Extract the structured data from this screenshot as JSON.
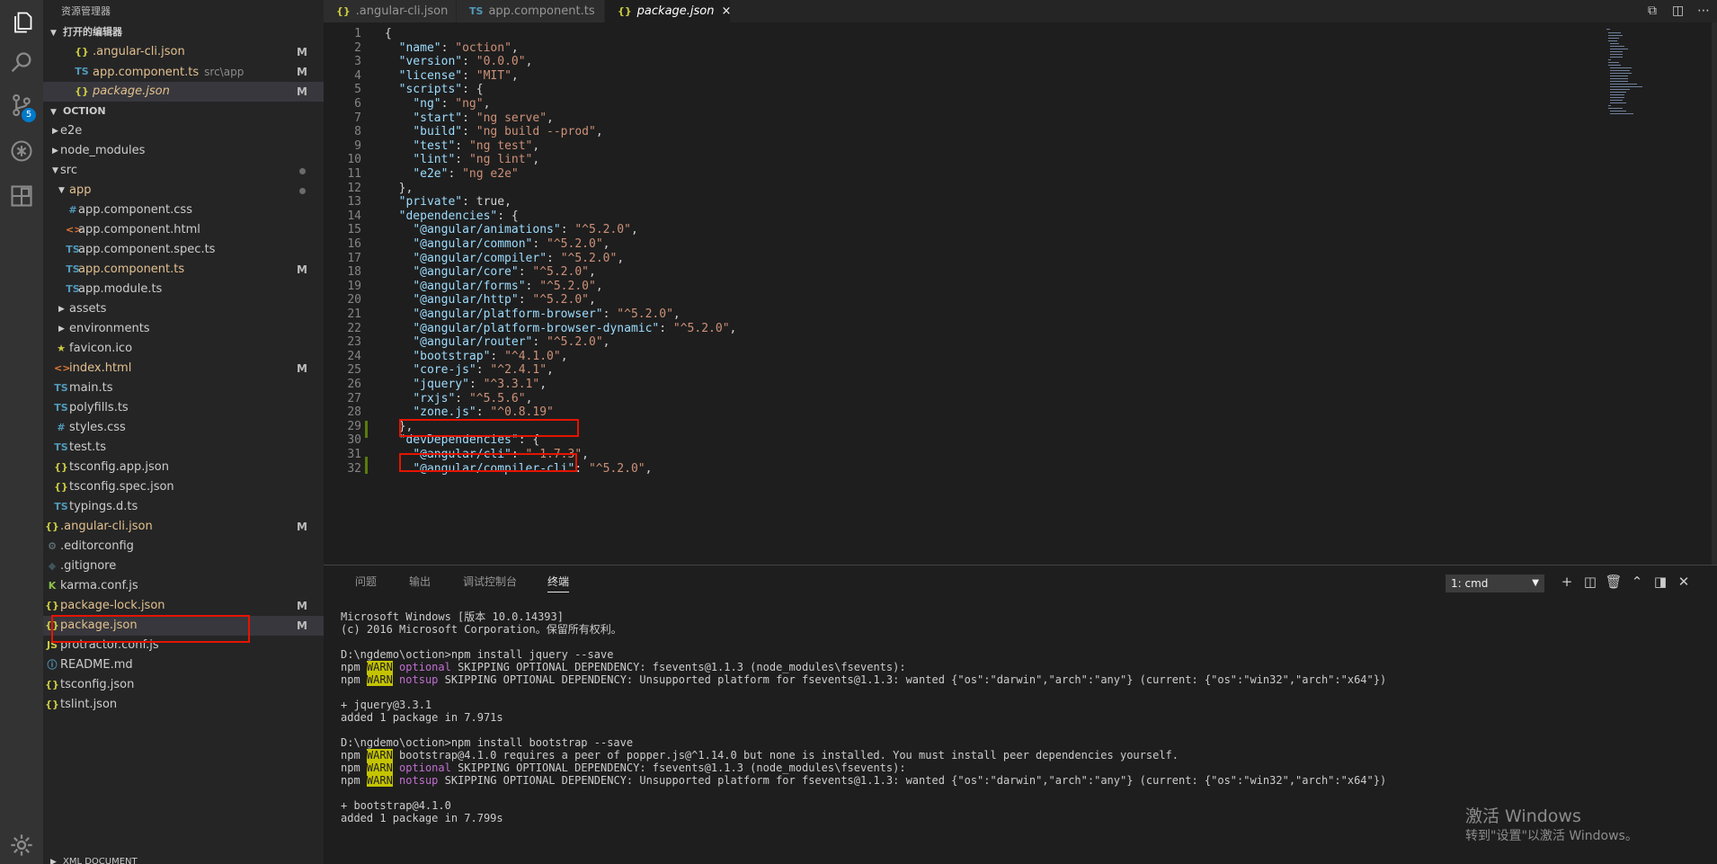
{
  "activity_bar": {
    "items": [
      {
        "name": "explorer-icon"
      },
      {
        "name": "search-icon"
      },
      {
        "name": "source-control-icon",
        "badge": "5"
      },
      {
        "name": "debug-icon"
      },
      {
        "name": "extensions-icon"
      }
    ],
    "settings": "gear-icon"
  },
  "sidebar": {
    "title": "资源管理器",
    "open_editors": {
      "header": "打开的编辑器",
      "items": [
        {
          "icon": "{}",
          "name": ".angular-cli.json",
          "desc": "",
          "status": "M"
        },
        {
          "icon": "TS",
          "name": "app.component.ts",
          "desc": "src\\app",
          "status": "M"
        },
        {
          "icon": "{}",
          "name": "package.json",
          "desc": "",
          "status": "M"
        }
      ]
    },
    "project": {
      "header": "OCTION",
      "items": [
        {
          "name": "e2e",
          "status": ""
        },
        {
          "name": "node_modules",
          "status": ""
        },
        {
          "name": "src",
          "status": ""
        },
        {
          "name": "app",
          "status": ""
        },
        {
          "icon": "#",
          "name": "app.component.css",
          "status": ""
        },
        {
          "icon": "<>",
          "name": "app.component.html",
          "status": ""
        },
        {
          "icon": "TS",
          "name": "app.component.spec.ts",
          "status": ""
        },
        {
          "icon": "TS",
          "name": "app.component.ts",
          "status": "M"
        },
        {
          "icon": "TS",
          "name": "app.module.ts",
          "status": ""
        },
        {
          "name": "assets",
          "status": ""
        },
        {
          "name": "environments",
          "status": ""
        },
        {
          "icon": "★",
          "name": "favicon.ico",
          "status": ""
        },
        {
          "icon": "<>",
          "name": "index.html",
          "status": "M"
        },
        {
          "icon": "TS",
          "name": "main.ts",
          "status": ""
        },
        {
          "icon": "TS",
          "name": "polyfills.ts",
          "status": ""
        },
        {
          "icon": "#",
          "name": "styles.css",
          "status": ""
        },
        {
          "icon": "TS",
          "name": "test.ts",
          "status": ""
        },
        {
          "icon": "{}",
          "name": "tsconfig.app.json",
          "status": ""
        },
        {
          "icon": "{}",
          "name": "tsconfig.spec.json",
          "status": ""
        },
        {
          "icon": "TS",
          "name": "typings.d.ts",
          "status": ""
        },
        {
          "icon": "{}",
          "name": ".angular-cli.json",
          "status": "M"
        },
        {
          "icon": "⚙",
          "name": ".editorconfig",
          "status": ""
        },
        {
          "icon": "◆",
          "name": ".gitignore",
          "status": ""
        },
        {
          "icon": "K",
          "name": "karma.conf.js",
          "status": ""
        },
        {
          "icon": "{}",
          "name": "package-lock.json",
          "status": "M"
        },
        {
          "icon": "{}",
          "name": "package.json",
          "status": "M"
        },
        {
          "icon": "JS",
          "name": "protractor.conf.js",
          "status": ""
        },
        {
          "icon": "ⓘ",
          "name": "README.md",
          "status": ""
        },
        {
          "icon": "{}",
          "name": "tsconfig.json",
          "status": ""
        },
        {
          "icon": "{}",
          "name": "tslint.json",
          "status": ""
        }
      ]
    },
    "outline_header": "XML DOCUMENT"
  },
  "tabs": [
    {
      "icon": "{}",
      "label": ".angular-cli.json"
    },
    {
      "icon": "TS",
      "label": "app.component.ts"
    },
    {
      "icon": "{}",
      "label": "package.json",
      "close": "×"
    }
  ],
  "editor": {
    "line_numbers": [
      "1",
      "2",
      "3",
      "4",
      "5",
      "6",
      "7",
      "8",
      "9",
      "10",
      "11",
      "12",
      "13",
      "14",
      "15",
      "16",
      "17",
      "18",
      "19",
      "20",
      "21",
      "22",
      "23",
      "24",
      "25",
      "26",
      "27",
      "28",
      "29",
      "30",
      "31",
      "32"
    ],
    "lines": [
      "{",
      "  \"name\": \"oction\",",
      "  \"version\": \"0.0.0\",",
      "  \"license\": \"MIT\",",
      "  \"scripts\": {",
      "    \"ng\": \"ng\",",
      "    \"start\": \"ng serve\",",
      "    \"build\": \"ng build --prod\",",
      "    \"test\": \"ng test\",",
      "    \"lint\": \"ng lint\",",
      "    \"e2e\": \"ng e2e\"",
      "  },",
      "  \"private\": true,",
      "  \"dependencies\": {",
      "    \"@angular/animations\": \"^5.2.0\",",
      "    \"@angular/common\": \"^5.2.0\",",
      "    \"@angular/compiler\": \"^5.2.0\",",
      "    \"@angular/core\": \"^5.2.0\",",
      "    \"@angular/forms\": \"^5.2.0\",",
      "    \"@angular/http\": \"^5.2.0\",",
      "    \"@angular/platform-browser\": \"^5.2.0\",",
      "    \"@angular/platform-browser-dynamic\": \"^5.2.0\",",
      "    \"@angular/router\": \"^5.2.0\",",
      "    \"bootstrap\": \"^4.1.0\",",
      "    \"core-js\": \"^2.4.1\",",
      "    \"jquery\": \"^3.3.1\",",
      "    \"rxjs\": \"^5.5.6\",",
      "    \"zone.js\": \"^0.8.19\"",
      "  },",
      "  \"devDependencies\": {",
      "    \"@angular/cli\": \"~1.7.3\",",
      "    \"@angular/compiler-cli\": \"^5.2.0\","
    ]
  },
  "panel": {
    "tabs": [
      "问题",
      "输出",
      "调试控制台",
      "终端"
    ],
    "terminal_select": "1: cmd",
    "actions": [
      "plus-icon",
      "split-icon",
      "trash-icon",
      "chevron-up-icon",
      "layout-icon",
      "close-icon"
    ],
    "terminal_lines": [
      "Microsoft Windows [版本 10.0.14393]",
      "(c) 2016 Microsoft Corporation。保留所有权利。",
      "",
      "D:\\ngdemo\\oction>npm install jquery --save",
      "npm |WARN| ~optional~ SKIPPING OPTIONAL DEPENDENCY: fsevents@1.1.3 (node_modules\\fsevents):",
      "npm |WARN| ~notsup~ SKIPPING OPTIONAL DEPENDENCY: Unsupported platform for fsevents@1.1.3: wanted {\"os\":\"darwin\",\"arch\":\"any\"} (current: {\"os\":\"win32\",\"arch\":\"x64\"})",
      "",
      "+ jquery@3.3.1",
      "added 1 package in 7.971s",
      "",
      "D:\\ngdemo\\oction>npm install bootstrap --save",
      "npm |WARN| bootstrap@4.1.0 requires a peer of popper.js@^1.14.0 but none is installed. You must install peer dependencies yourself.",
      "npm |WARN| ~optional~ SKIPPING OPTIONAL DEPENDENCY: fsevents@1.1.3 (node_modules\\fsevents):",
      "npm |WARN| ~notsup~ SKIPPING OPTIONAL DEPENDENCY: Unsupported platform for fsevents@1.1.3: wanted {\"os\":\"darwin\",\"arch\":\"any\"} (current: {\"os\":\"win32\",\"arch\":\"x64\"})",
      "",
      "+ bootstrap@4.1.0",
      "added 1 package in 7.799s"
    ]
  },
  "watermark": {
    "line1": "激活 Windows",
    "line2": "转到\"设置\"以激活 Windows。"
  },
  "colors": {
    "accent": "#007acc",
    "highlight_box": "#e51400",
    "modified": "#e2c08d",
    "warn_bg": "#c4c400"
  }
}
